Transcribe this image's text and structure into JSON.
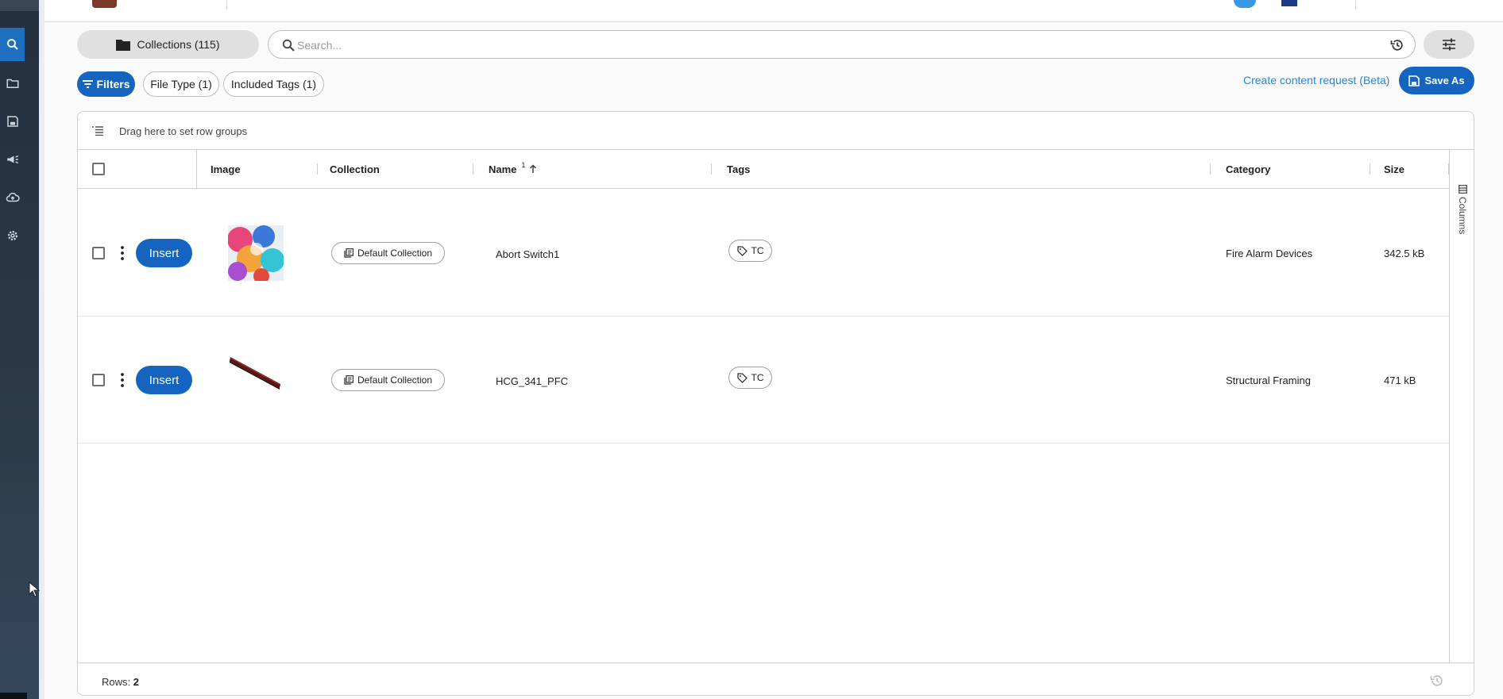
{
  "rail": {
    "items": [
      {
        "icon": "search-icon",
        "active": true
      },
      {
        "icon": "folder-icon",
        "active": false
      },
      {
        "icon": "save-icon",
        "active": false
      },
      {
        "icon": "campaign-icon",
        "active": false
      },
      {
        "icon": "cloud-upload-icon",
        "active": false
      },
      {
        "icon": "settings-icon",
        "active": false
      }
    ]
  },
  "toolbar": {
    "collections_label": "Collections (115)",
    "search_placeholder": "Search...",
    "filters_label": "Filters",
    "chips": [
      "File Type (1)",
      "Included Tags (1)"
    ],
    "create_request_label": "Create content request (Beta)",
    "save_as_label": "Save As"
  },
  "grid": {
    "group_hint": "Drag here to set row groups",
    "columns": {
      "image": "Image",
      "collection": "Collection",
      "name": "Name",
      "name_sort_index": "1",
      "tags": "Tags",
      "category": "Category",
      "size": "Size"
    },
    "side_panel_label": "Columns",
    "insert_label": "Insert",
    "rows": [
      {
        "collection": "Default Collection",
        "name": "Abort Switch1",
        "tag": "TC",
        "category": "Fire Alarm Devices",
        "size": "342.5 kB"
      },
      {
        "collection": "Default Collection",
        "name": "HCG_341_PFC",
        "tag": "TC",
        "category": "Structural Framing",
        "size": "471 kB"
      }
    ],
    "footer": {
      "rows_label": "Rows:",
      "rows_count": "2"
    }
  },
  "colors": {
    "primary": "#1565c0",
    "link": "#1e88e5",
    "rail_bg": "#2b3947"
  }
}
